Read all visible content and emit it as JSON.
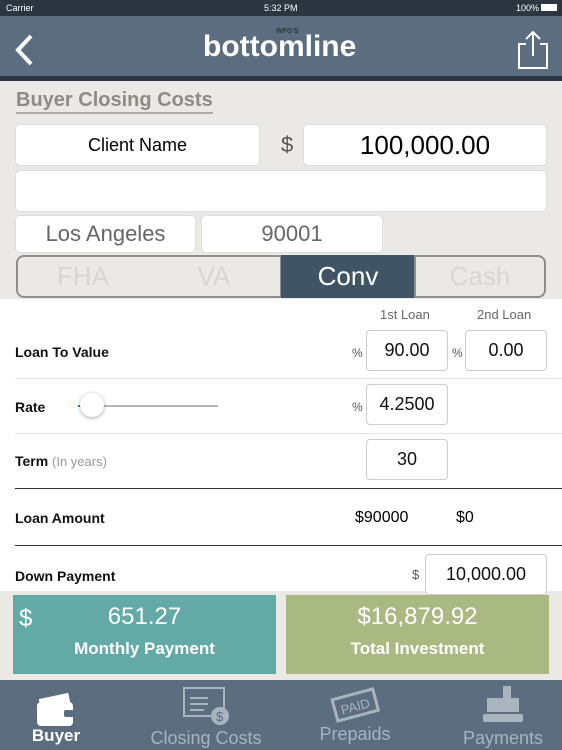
{
  "status": {
    "carrier": "Carrier",
    "time": "5:32 PM",
    "battery": "100%"
  },
  "nav": {
    "logo_small": "WFG'S",
    "logo": "bottomline",
    "back_icon": "chevron-left-icon",
    "share_icon": "share-icon"
  },
  "page_title": "Buyer Closing Costs",
  "client": {
    "name": "Client Name",
    "currency": "$",
    "amount": "100,000.00",
    "address": "",
    "city": "Los Angeles",
    "zip": "90001"
  },
  "loan_types": [
    {
      "label": "FHA",
      "selected": false
    },
    {
      "label": "VA",
      "selected": false
    },
    {
      "label": "Conv",
      "selected": true
    },
    {
      "label": "Cash",
      "selected": false
    }
  ],
  "form": {
    "col1": "1st Loan",
    "col2": "2nd Loan",
    "ltv_label": "Loan To Value",
    "pct": "%",
    "ltv1": "90.00",
    "ltv2": "0.00",
    "rate_label": "Rate",
    "rate": "4.2500",
    "rate_slider": 0.05,
    "term_label": "Term",
    "term_hint": "(In years)",
    "term": "30",
    "loan_amount_label": "Loan Amount",
    "loan1": "$90000",
    "loan2": "$0",
    "down_label": "Down Payment",
    "down_currency": "$",
    "down": "10,000.00"
  },
  "summary": {
    "monthly_currency": "$",
    "monthly": "651.27",
    "monthly_label": "Monthly Payment",
    "total": "$16,879.92",
    "total_label": "Total Investment",
    "monthly_color": "#63aaa6",
    "total_color": "#aab882"
  },
  "tabs": [
    {
      "label": "Buyer",
      "icon": "wallet-icon",
      "active": true
    },
    {
      "label": "Closing Costs",
      "icon": "invoice-dollar-icon",
      "active": false
    },
    {
      "label": "Prepaids",
      "icon": "paid-stamp-icon",
      "active": false
    },
    {
      "label": "Payments",
      "icon": "cash-register-icon",
      "active": false
    }
  ]
}
